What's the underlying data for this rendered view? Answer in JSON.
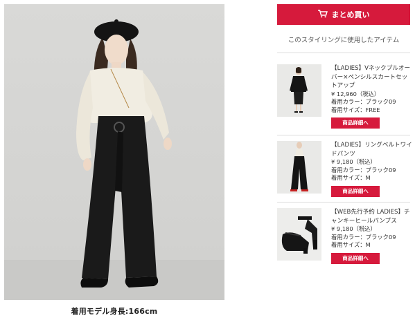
{
  "bulk_buy": {
    "label": "まとめ買い",
    "icon": "cart-icon",
    "color": "#d61a3c"
  },
  "section_title": "このスタイリングに使用したアイテム",
  "model_caption": "着用モデル身長:166cm",
  "items": [
    {
      "name": "【LADIES】Vネックプルオーバー×ペンシルスカートセットアップ",
      "price": "¥ 12,960（税込）",
      "color": "着用カラー：ブラック09",
      "size": "着用サイズ：FREE",
      "button": "商品詳細へ"
    },
    {
      "name": "【LADIES】リングベルトワイドパンツ",
      "price": "¥ 9,180（税込）",
      "color": "着用カラー：ブラック09",
      "size": "着用サイズ：M",
      "button": "商品詳細へ"
    },
    {
      "name": "【WEB先行予約 LADIES】チャンキーヒールパンプス",
      "price": "¥ 9,180（税込）",
      "color": "着用カラー：ブラック09",
      "size": "着用サイズ：M",
      "button": "商品詳細へ"
    }
  ]
}
